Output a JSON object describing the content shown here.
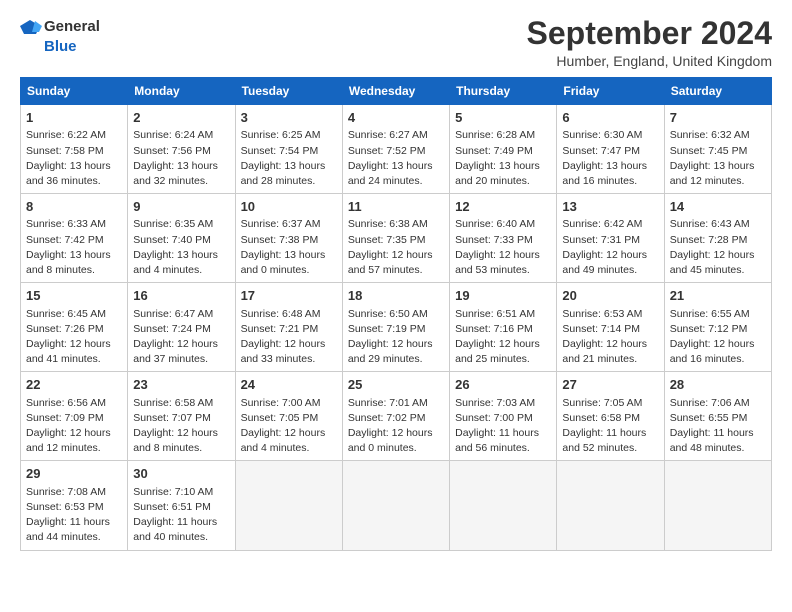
{
  "header": {
    "logo_line1": "General",
    "logo_line2": "Blue",
    "title": "September 2024",
    "subtitle": "Humber, England, United Kingdom"
  },
  "days_of_week": [
    "Sunday",
    "Monday",
    "Tuesday",
    "Wednesday",
    "Thursday",
    "Friday",
    "Saturday"
  ],
  "weeks": [
    [
      {
        "day": "1",
        "info": "Sunrise: 6:22 AM\nSunset: 7:58 PM\nDaylight: 13 hours\nand 36 minutes."
      },
      {
        "day": "2",
        "info": "Sunrise: 6:24 AM\nSunset: 7:56 PM\nDaylight: 13 hours\nand 32 minutes."
      },
      {
        "day": "3",
        "info": "Sunrise: 6:25 AM\nSunset: 7:54 PM\nDaylight: 13 hours\nand 28 minutes."
      },
      {
        "day": "4",
        "info": "Sunrise: 6:27 AM\nSunset: 7:52 PM\nDaylight: 13 hours\nand 24 minutes."
      },
      {
        "day": "5",
        "info": "Sunrise: 6:28 AM\nSunset: 7:49 PM\nDaylight: 13 hours\nand 20 minutes."
      },
      {
        "day": "6",
        "info": "Sunrise: 6:30 AM\nSunset: 7:47 PM\nDaylight: 13 hours\nand 16 minutes."
      },
      {
        "day": "7",
        "info": "Sunrise: 6:32 AM\nSunset: 7:45 PM\nDaylight: 13 hours\nand 12 minutes."
      }
    ],
    [
      {
        "day": "8",
        "info": "Sunrise: 6:33 AM\nSunset: 7:42 PM\nDaylight: 13 hours\nand 8 minutes."
      },
      {
        "day": "9",
        "info": "Sunrise: 6:35 AM\nSunset: 7:40 PM\nDaylight: 13 hours\nand 4 minutes."
      },
      {
        "day": "10",
        "info": "Sunrise: 6:37 AM\nSunset: 7:38 PM\nDaylight: 13 hours\nand 0 minutes."
      },
      {
        "day": "11",
        "info": "Sunrise: 6:38 AM\nSunset: 7:35 PM\nDaylight: 12 hours\nand 57 minutes."
      },
      {
        "day": "12",
        "info": "Sunrise: 6:40 AM\nSunset: 7:33 PM\nDaylight: 12 hours\nand 53 minutes."
      },
      {
        "day": "13",
        "info": "Sunrise: 6:42 AM\nSunset: 7:31 PM\nDaylight: 12 hours\nand 49 minutes."
      },
      {
        "day": "14",
        "info": "Sunrise: 6:43 AM\nSunset: 7:28 PM\nDaylight: 12 hours\nand 45 minutes."
      }
    ],
    [
      {
        "day": "15",
        "info": "Sunrise: 6:45 AM\nSunset: 7:26 PM\nDaylight: 12 hours\nand 41 minutes."
      },
      {
        "day": "16",
        "info": "Sunrise: 6:47 AM\nSunset: 7:24 PM\nDaylight: 12 hours\nand 37 minutes."
      },
      {
        "day": "17",
        "info": "Sunrise: 6:48 AM\nSunset: 7:21 PM\nDaylight: 12 hours\nand 33 minutes."
      },
      {
        "day": "18",
        "info": "Sunrise: 6:50 AM\nSunset: 7:19 PM\nDaylight: 12 hours\nand 29 minutes."
      },
      {
        "day": "19",
        "info": "Sunrise: 6:51 AM\nSunset: 7:16 PM\nDaylight: 12 hours\nand 25 minutes."
      },
      {
        "day": "20",
        "info": "Sunrise: 6:53 AM\nSunset: 7:14 PM\nDaylight: 12 hours\nand 21 minutes."
      },
      {
        "day": "21",
        "info": "Sunrise: 6:55 AM\nSunset: 7:12 PM\nDaylight: 12 hours\nand 16 minutes."
      }
    ],
    [
      {
        "day": "22",
        "info": "Sunrise: 6:56 AM\nSunset: 7:09 PM\nDaylight: 12 hours\nand 12 minutes."
      },
      {
        "day": "23",
        "info": "Sunrise: 6:58 AM\nSunset: 7:07 PM\nDaylight: 12 hours\nand 8 minutes."
      },
      {
        "day": "24",
        "info": "Sunrise: 7:00 AM\nSunset: 7:05 PM\nDaylight: 12 hours\nand 4 minutes."
      },
      {
        "day": "25",
        "info": "Sunrise: 7:01 AM\nSunset: 7:02 PM\nDaylight: 12 hours\nand 0 minutes."
      },
      {
        "day": "26",
        "info": "Sunrise: 7:03 AM\nSunset: 7:00 PM\nDaylight: 11 hours\nand 56 minutes."
      },
      {
        "day": "27",
        "info": "Sunrise: 7:05 AM\nSunset: 6:58 PM\nDaylight: 11 hours\nand 52 minutes."
      },
      {
        "day": "28",
        "info": "Sunrise: 7:06 AM\nSunset: 6:55 PM\nDaylight: 11 hours\nand 48 minutes."
      }
    ],
    [
      {
        "day": "29",
        "info": "Sunrise: 7:08 AM\nSunset: 6:53 PM\nDaylight: 11 hours\nand 44 minutes."
      },
      {
        "day": "30",
        "info": "Sunrise: 7:10 AM\nSunset: 6:51 PM\nDaylight: 11 hours\nand 40 minutes."
      },
      {
        "day": "",
        "info": ""
      },
      {
        "day": "",
        "info": ""
      },
      {
        "day": "",
        "info": ""
      },
      {
        "day": "",
        "info": ""
      },
      {
        "day": "",
        "info": ""
      }
    ]
  ]
}
